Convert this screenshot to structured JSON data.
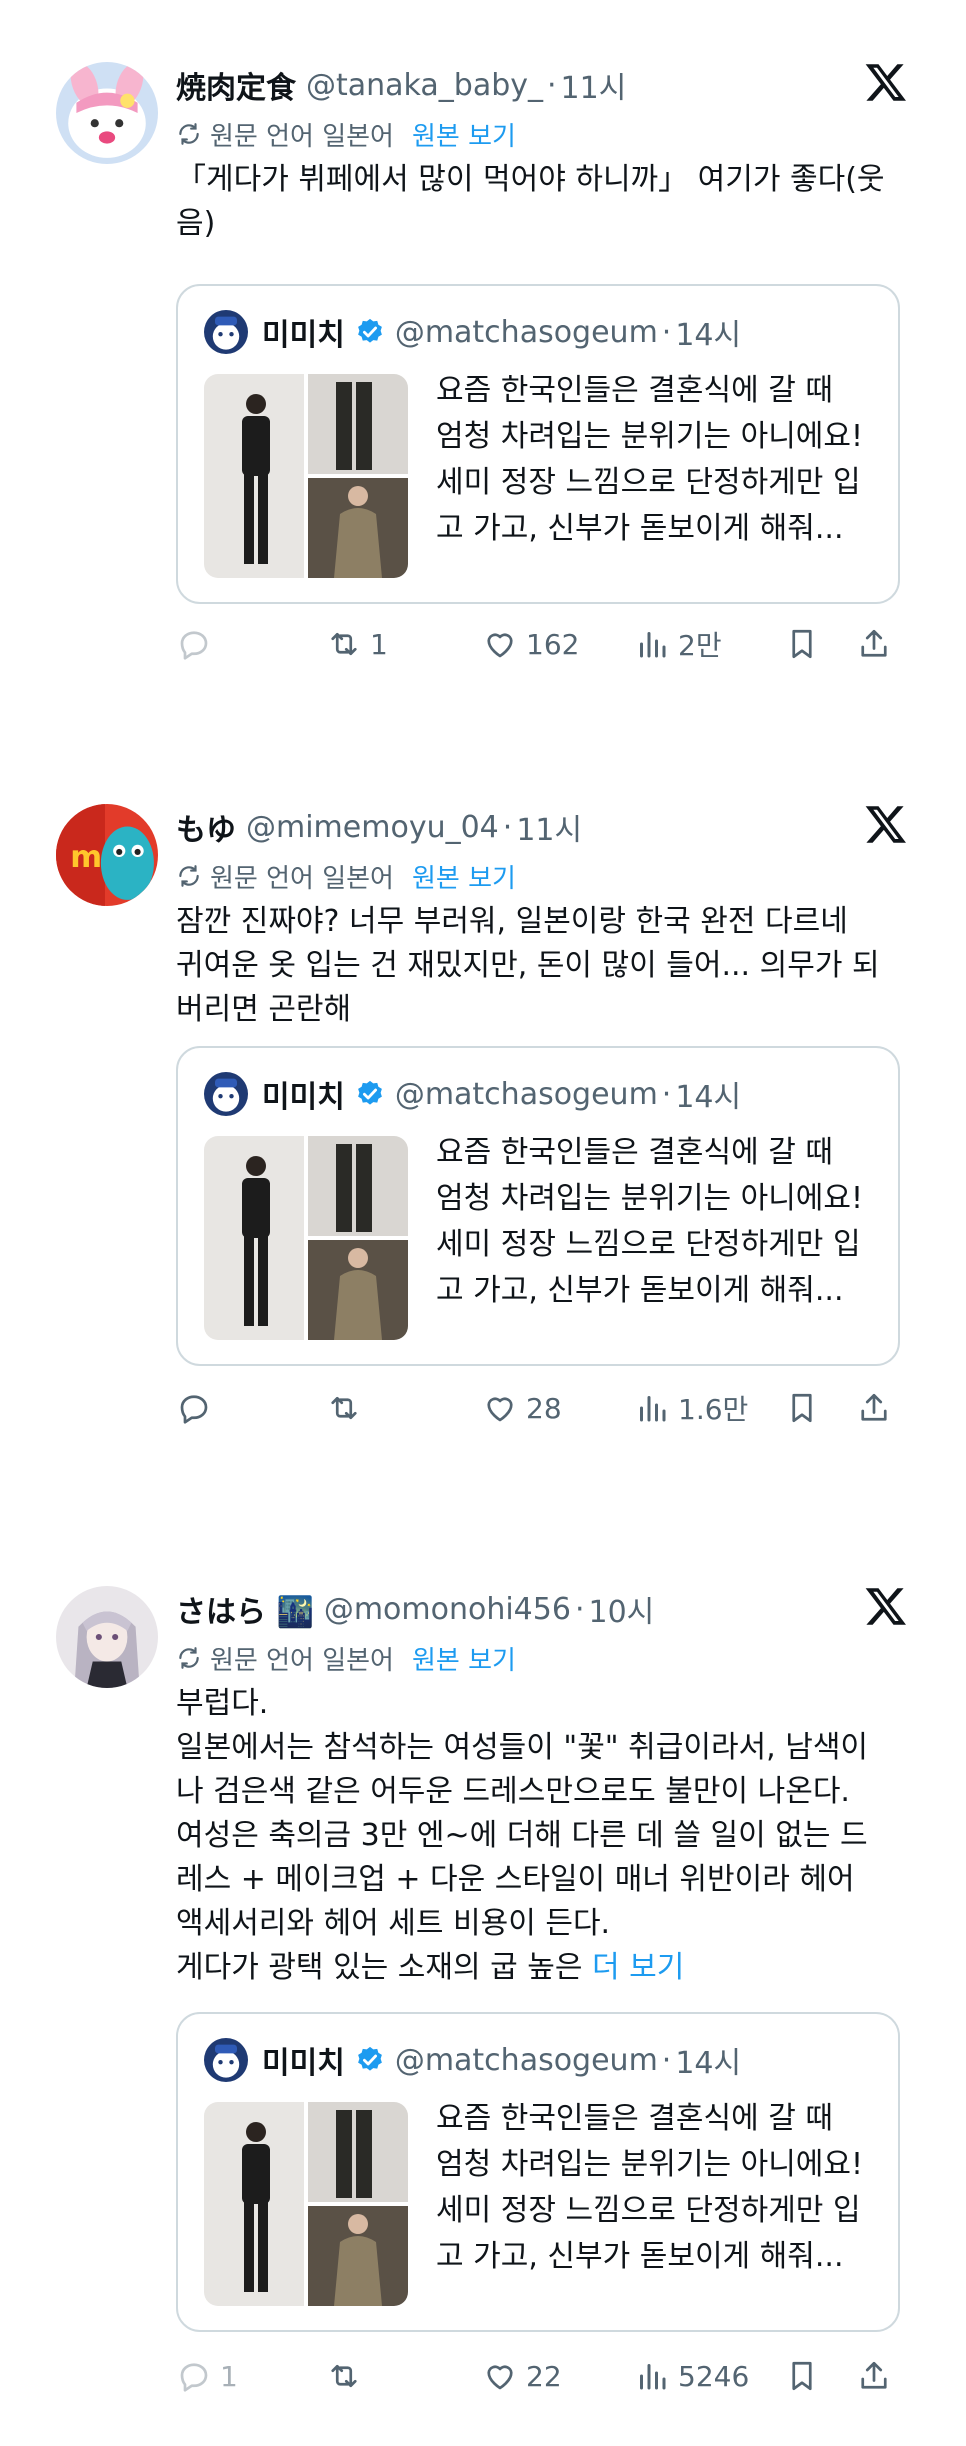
{
  "tweets": [
    {
      "display_name": "焼肉定食",
      "handle": "@tanaka_baby_",
      "dot": "·",
      "time": "11시",
      "translate_label": "원문 언어 일본어",
      "show_original": "원본 보기",
      "body_lines": [
        "「게다가 뷔페에서 많이 먹어야 하니까」 여기가 좋다(웃",
        "음)"
      ],
      "more": "",
      "quote": {
        "display_name": "미미치",
        "handle": "@matchasogeum",
        "dot": "·",
        "time": "14시",
        "text_lines": [
          "요즘 한국인들은 결혼식에 갈 때",
          "엄청 차려입는 분위기는 아니에요!",
          "세미 정장 느낌으로 단정하게만 입",
          "고 가고, 신부가 돋보이게 해줘..."
        ]
      },
      "actions": {
        "reply": "",
        "repost": "1",
        "like": "162",
        "views": "2만"
      }
    },
    {
      "display_name": "もゆ",
      "handle": "@mimemoyu_04",
      "dot": "·",
      "time": "11시",
      "translate_label": "원문 언어 일본어",
      "show_original": "원본 보기",
      "body_lines": [
        "잠깐 진짜야? 너무 부러워, 일본이랑 한국 완전 다르네",
        "귀여운 옷 입는 건 재밌지만, 돈이 많이 들어... 의무가 되",
        "버리면 곤란해"
      ],
      "more": "",
      "quote": {
        "display_name": "미미치",
        "handle": "@matchasogeum",
        "dot": "·",
        "time": "14시",
        "text_lines": [
          "요즘 한국인들은 결혼식에 갈 때",
          "엄청 차려입는 분위기는 아니에요!",
          "세미 정장 느낌으로 단정하게만 입",
          "고 가고, 신부가 돋보이게 해줘..."
        ]
      },
      "actions": {
        "reply": "",
        "repost": "",
        "like": "28",
        "views": "1.6만"
      }
    },
    {
      "display_name": "さはら 🌃",
      "handle": "@momonohi456",
      "dot": "·",
      "time": "10시",
      "translate_label": "원문 언어 일본어",
      "show_original": "원본 보기",
      "body_lines": [
        "부럽다.",
        "일본에서는 참석하는 여성들이 \"꽃\" 취급이라서, 남색이",
        "나 검은색 같은 어두운 드레스만으로도 불만이 나온다.",
        "여성은 축의금 3만 엔~에 더해 다른 데 쓸 일이 없는 드",
        "레스 + 메이크업 + 다운 스타일이 매너 위반이라 헤어",
        "액세서리와 헤어 세트 비용이 든다."
      ],
      "last_line": "게다가 광택 있는 소재의 굽 높은 ",
      "more": "더 보기",
      "quote": {
        "display_name": "미미치",
        "handle": "@matchasogeum",
        "dot": "·",
        "time": "14시",
        "text_lines": [
          "요즘 한국인들은 결혼식에 갈 때",
          "엄청 차려입는 분위기는 아니에요!",
          "세미 정장 느낌으로 단정하게만 입",
          "고 가고, 신부가 돋보이게 해줘..."
        ]
      },
      "actions": {
        "reply": "1",
        "repost": "",
        "like": "22",
        "views": "5246"
      }
    }
  ],
  "colors": {
    "text": "#0f1419",
    "secondary": "#536471",
    "link": "#1d9bf0",
    "border": "#cfd9de"
  },
  "icons": [
    "x-logo-icon",
    "translate-icon",
    "verified-icon",
    "reply-icon",
    "repost-icon",
    "like-icon",
    "views-icon",
    "bookmark-icon",
    "share-icon"
  ]
}
